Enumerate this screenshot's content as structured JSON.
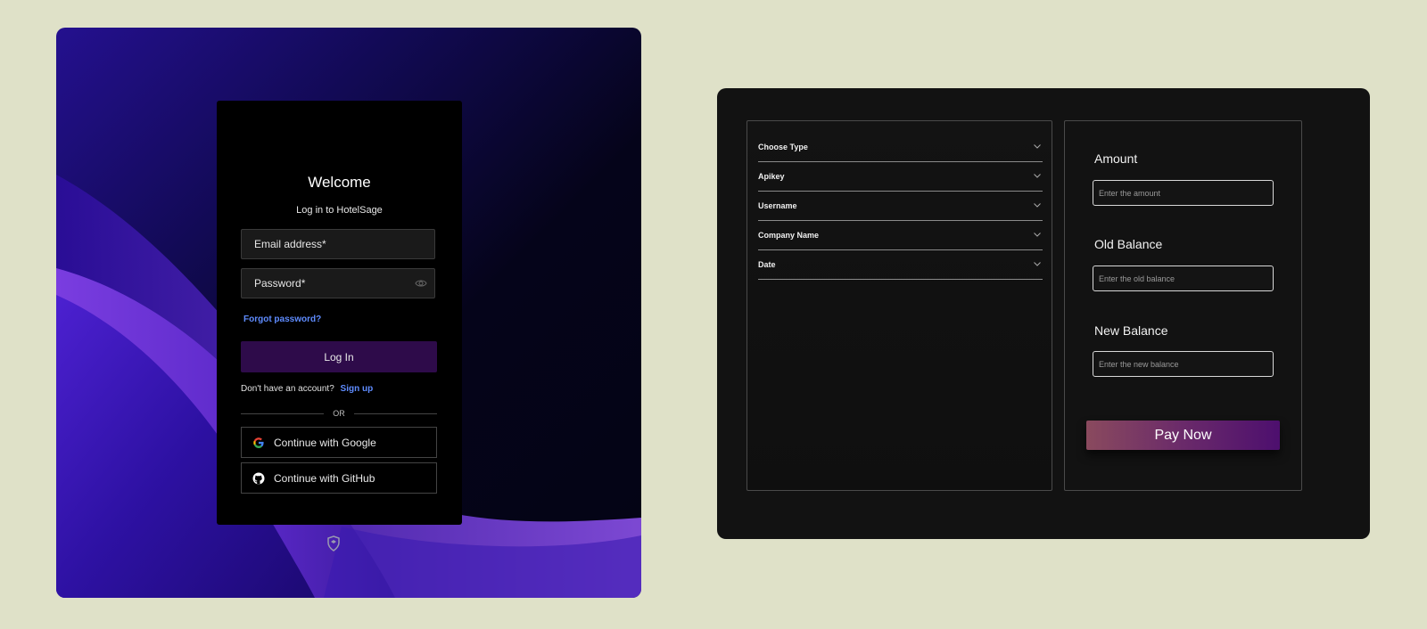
{
  "login": {
    "title": "Welcome",
    "subtitle": "Log in to HotelSage",
    "email_placeholder": "Email address*",
    "password_placeholder": "Password*",
    "forgot": "Forgot password?",
    "login_button": "Log In",
    "no_account": "Don't have an account?",
    "signup": "Sign up",
    "or": "OR",
    "google": "Continue with Google",
    "github": "Continue with GitHub"
  },
  "payment": {
    "accordion": [
      "Choose Type",
      "Apikey",
      "Username",
      "Company Name",
      "Date"
    ],
    "fields": [
      {
        "label": "Amount",
        "placeholder": "Enter the amount"
      },
      {
        "label": "Old Balance",
        "placeholder": "Enter the old balance"
      },
      {
        "label": "New Balance",
        "placeholder": "Enter the new balance"
      }
    ],
    "pay_button": "Pay Now"
  },
  "colors": {
    "page_bg": "#dfe1c8",
    "link": "#5f8cff",
    "login_button": "#2e0b4a",
    "card_bg": "#000000",
    "panel_bg": "#121212"
  }
}
